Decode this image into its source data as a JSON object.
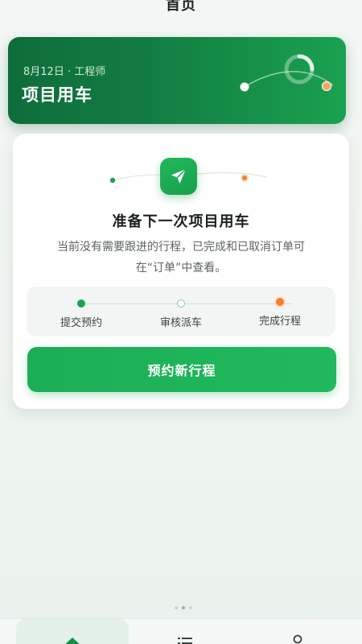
{
  "header": {
    "title": "首页"
  },
  "hero": {
    "subtitle": "8月12日 · 工程师",
    "title": "项目用车"
  },
  "main": {
    "heading": "准备下一次项目用车",
    "description": "当前没有需要跟进的行程，已完成和已取消订单可在“订单”中查看。",
    "steps": [
      {
        "label": "提交预约",
        "status": "done",
        "color": "#1aa350"
      },
      {
        "label": "审核派车",
        "status": "pending",
        "color": "#ffffff"
      },
      {
        "label": "完成行程",
        "status": "end",
        "color": "#f07f2c"
      }
    ],
    "button_label": "预约新行程"
  },
  "tabbar": {
    "tabs": [
      {
        "icon": "home-icon",
        "active": true
      },
      {
        "icon": "list-icon",
        "active": false
      },
      {
        "icon": "user-icon",
        "active": false
      }
    ]
  },
  "indicator": {
    "page_count": 3,
    "active_index": 1
  },
  "colors": {
    "brand_green": "#1aa350",
    "hero_dark": "#0e6d3a",
    "accent_orange": "#f07f2c"
  }
}
